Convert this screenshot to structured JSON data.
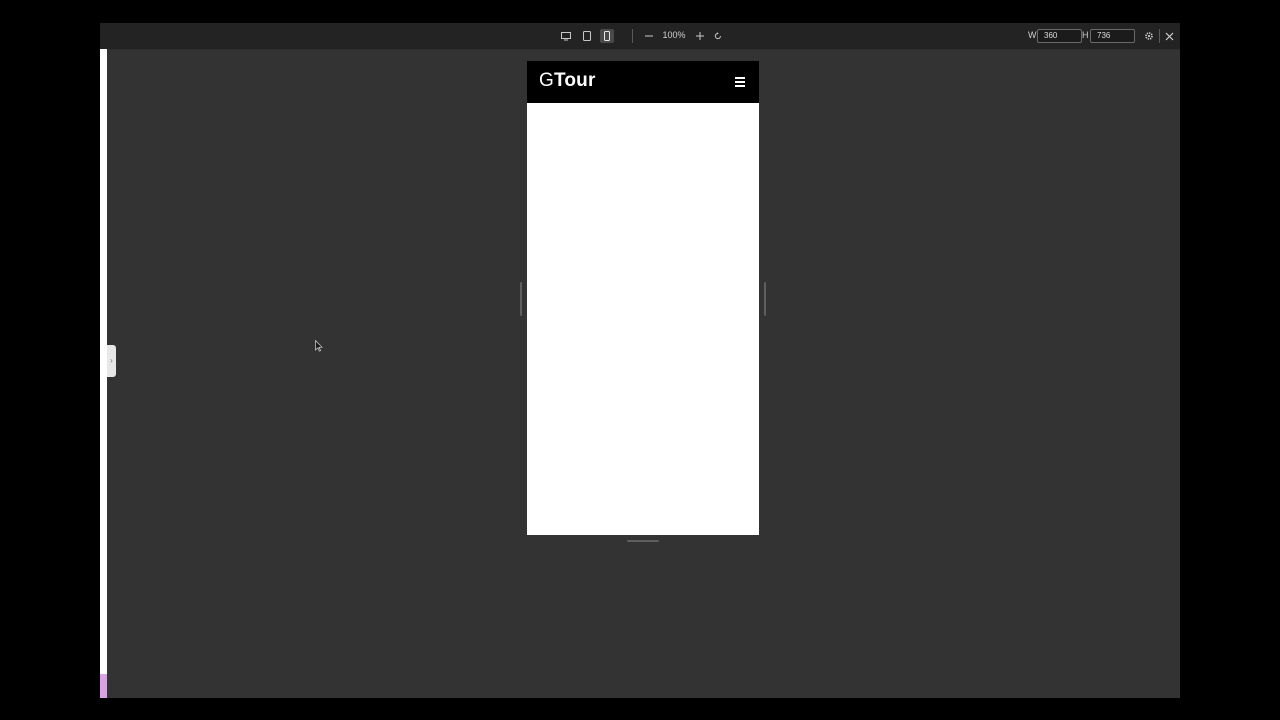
{
  "toolbar": {
    "zoom": "100%",
    "width_label": "W",
    "width_value": "360",
    "height_label": "H",
    "height_value": "736",
    "active_device": "mobile"
  },
  "preview": {
    "logo_prefix": "G",
    "logo_rest": "Tour",
    "header_bg": "#000000",
    "body_bg": "#ffffff"
  },
  "colors": {
    "canvas_bg": "#333333",
    "toolbar_bg": "#232323",
    "accent": "#d9a3e6"
  },
  "icons": {
    "desktop": "desktop-icon",
    "tablet": "tablet-icon",
    "mobile": "mobile-icon",
    "zoom_out": "minus-icon",
    "zoom_in": "plus-icon",
    "reset": "rotate-icon",
    "settings": "gear-icon",
    "close": "close-icon",
    "menu": "hamburger-icon",
    "toggle": "chevron-right-icon"
  }
}
